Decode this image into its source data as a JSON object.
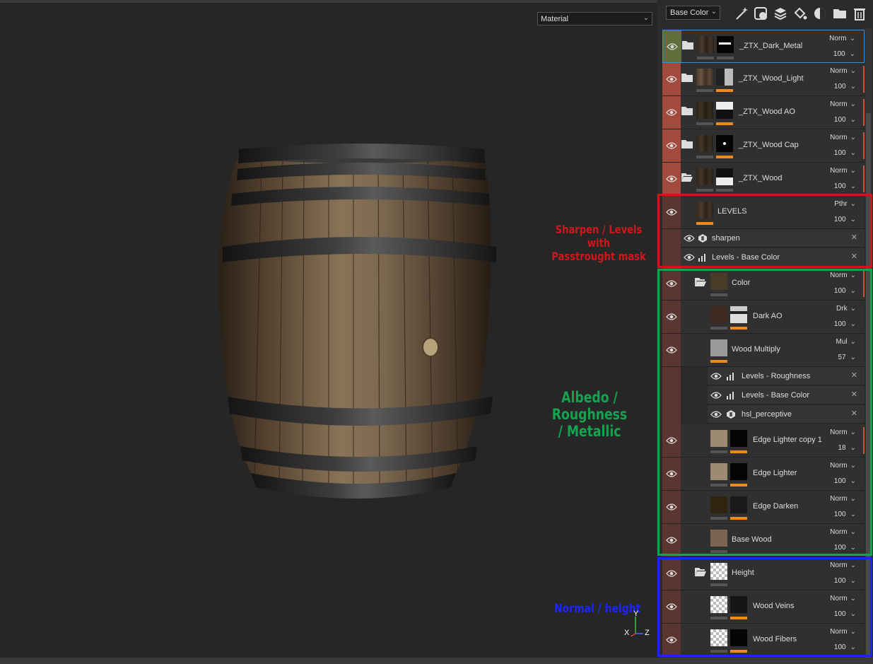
{
  "viewport": {
    "material_select": "Material",
    "annotations": {
      "red_line1": "Sharpen / Levels with",
      "red_line2": "Passtrought mask",
      "green_line1": "Albedo / Roughness",
      "green_line2": "/ Metallic",
      "blue": "Normal / height"
    },
    "axis": {
      "x": "X",
      "y": "Y",
      "z": "Z"
    }
  },
  "toolbar": {
    "channel_select": "Base Color",
    "icons": [
      "magic-wand-icon",
      "add-mask-icon",
      "add-layer-icon",
      "fill-icon",
      "color-icon",
      "add-folder-icon",
      "trash-icon"
    ]
  },
  "layers": [
    {
      "name": "_ZTX_Dark_Metal",
      "blend": "Norm",
      "opacity": "100"
    },
    {
      "name": "_ZTX_Wood_Light",
      "blend": "Norm",
      "opacity": "100"
    },
    {
      "name": "_ZTX_Wood AO",
      "blend": "Norm",
      "opacity": "100"
    },
    {
      "name": "_ZTX_Wood Cap",
      "blend": "Norm",
      "opacity": "100"
    },
    {
      "name": "_ZTX_Wood",
      "blend": "Norm",
      "opacity": "100"
    },
    {
      "name": "LEVELS",
      "blend": "Pthr",
      "opacity": "100"
    },
    {
      "name": "Color",
      "blend": "Norm",
      "opacity": "100"
    },
    {
      "name": "Dark AO",
      "blend": "Drk",
      "opacity": "100"
    },
    {
      "name": "Wood Multiply",
      "blend": "Mul",
      "opacity": "57"
    },
    {
      "name": "Edge Lighter copy 1",
      "blend": "Norm",
      "opacity": "18"
    },
    {
      "name": "Edge Lighter",
      "blend": "Norm",
      "opacity": "100"
    },
    {
      "name": "Edge Darken",
      "blend": "Norm",
      "opacity": "100"
    },
    {
      "name": "Base Wood",
      "blend": "Norm",
      "opacity": "100"
    },
    {
      "name": "Height",
      "blend": "Norm",
      "opacity": "100"
    },
    {
      "name": "Wood Veins",
      "blend": "Norm",
      "opacity": "100"
    },
    {
      "name": "Wood Fibers",
      "blend": "Norm",
      "opacity": "100"
    }
  ],
  "effects": {
    "levels_group": [
      "sharpen",
      "Levels - Base Color"
    ],
    "wood_multiply": [
      "Levels - Roughness",
      "Levels - Base Color",
      "hsl_perceptive"
    ]
  },
  "colors": {
    "annotation_red": "#d0161b",
    "annotation_green": "#14a44e",
    "annotation_blue": "#1c24ff",
    "layer_group_red": "#a24a3b",
    "layer_selected_green": "#5f6e3b",
    "child_layer_brown": "#5b3630",
    "opacity_orange": "#f08a1c"
  }
}
